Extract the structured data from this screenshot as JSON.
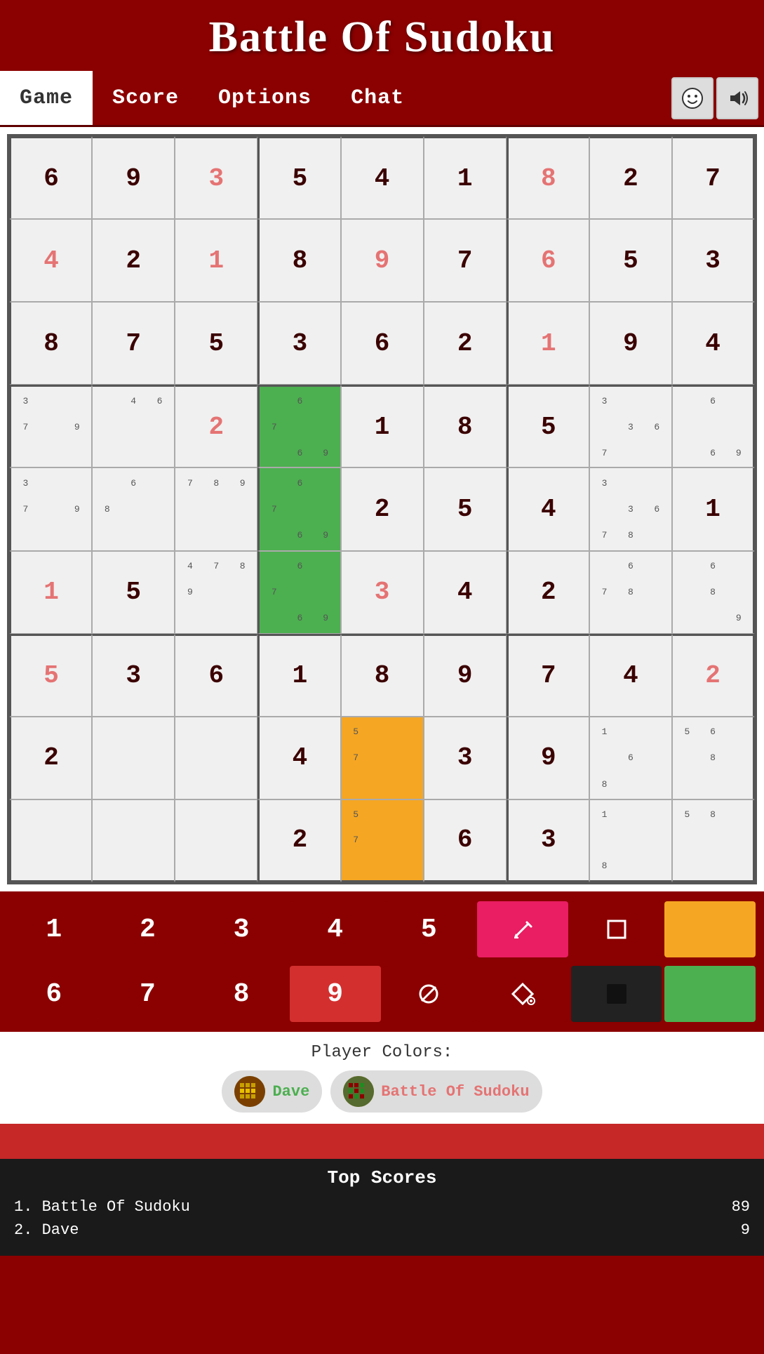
{
  "header": {
    "title": "Battle Of Sudoku"
  },
  "nav": {
    "tabs": [
      {
        "id": "game",
        "label": "Game",
        "active": true
      },
      {
        "id": "score",
        "label": "Score",
        "active": false
      },
      {
        "id": "options",
        "label": "Options",
        "active": false
      },
      {
        "id": "chat",
        "label": "Chat",
        "active": false
      }
    ]
  },
  "grid": {
    "rows": [
      [
        {
          "val": "6",
          "type": "given",
          "notes": null,
          "bg": ""
        },
        {
          "val": "9",
          "type": "given",
          "notes": null,
          "bg": ""
        },
        {
          "val": "3",
          "type": "player",
          "notes": null,
          "bg": ""
        },
        {
          "val": "5",
          "type": "given",
          "notes": null,
          "bg": ""
        },
        {
          "val": "4",
          "type": "given",
          "notes": null,
          "bg": ""
        },
        {
          "val": "1",
          "type": "given",
          "notes": null,
          "bg": ""
        },
        {
          "val": "8",
          "type": "player",
          "notes": null,
          "bg": ""
        },
        {
          "val": "2",
          "type": "given",
          "notes": null,
          "bg": ""
        },
        {
          "val": "7",
          "type": "given",
          "notes": null,
          "bg": ""
        }
      ],
      [
        {
          "val": "4",
          "type": "player",
          "notes": null,
          "bg": ""
        },
        {
          "val": "2",
          "type": "given",
          "notes": null,
          "bg": ""
        },
        {
          "val": "1",
          "type": "player",
          "notes": null,
          "bg": ""
        },
        {
          "val": "8",
          "type": "given",
          "notes": null,
          "bg": ""
        },
        {
          "val": "9",
          "type": "player",
          "notes": null,
          "bg": ""
        },
        {
          "val": "7",
          "type": "given",
          "notes": null,
          "bg": ""
        },
        {
          "val": "6",
          "type": "player",
          "notes": null,
          "bg": ""
        },
        {
          "val": "5",
          "type": "given",
          "notes": null,
          "bg": ""
        },
        {
          "val": "3",
          "type": "given",
          "notes": null,
          "bg": ""
        }
      ],
      [
        {
          "val": "8",
          "type": "given",
          "notes": null,
          "bg": ""
        },
        {
          "val": "7",
          "type": "given",
          "notes": null,
          "bg": ""
        },
        {
          "val": "5",
          "type": "given",
          "notes": null,
          "bg": ""
        },
        {
          "val": "3",
          "type": "given",
          "notes": null,
          "bg": ""
        },
        {
          "val": "6",
          "type": "given",
          "notes": null,
          "bg": ""
        },
        {
          "val": "2",
          "type": "given",
          "notes": null,
          "bg": ""
        },
        {
          "val": "1",
          "type": "player",
          "notes": null,
          "bg": ""
        },
        {
          "val": "9",
          "type": "given",
          "notes": null,
          "bg": ""
        },
        {
          "val": "4",
          "type": "given",
          "notes": null,
          "bg": ""
        }
      ],
      [
        {
          "val": "",
          "type": "notes",
          "notes": [
            "3",
            "",
            "",
            "7",
            "",
            "9"
          ],
          "bg": ""
        },
        {
          "val": "",
          "type": "notes",
          "notes": [
            "",
            "4",
            "6",
            "",
            "",
            ""
          ],
          "bg": ""
        },
        {
          "val": "2",
          "type": "player",
          "notes": null,
          "bg": ""
        },
        {
          "val": "",
          "type": "notes",
          "notes": [
            "",
            "6",
            "",
            "7",
            "",
            "",
            "",
            "6",
            "9"
          ],
          "bg": "green"
        },
        {
          "val": "1",
          "type": "given",
          "notes": null,
          "bg": ""
        },
        {
          "val": "8",
          "type": "given",
          "notes": null,
          "bg": ""
        },
        {
          "val": "5",
          "type": "given",
          "notes": null,
          "bg": ""
        },
        {
          "val": "",
          "type": "notes",
          "notes": [
            "3",
            "",
            "",
            "",
            "3",
            "6",
            "7",
            "",
            ""
          ],
          "bg": ""
        },
        {
          "val": "",
          "type": "notes",
          "notes": [
            "",
            "6",
            "",
            "",
            "",
            "",
            "",
            "6",
            "9"
          ],
          "bg": ""
        }
      ],
      [
        {
          "val": "",
          "type": "notes",
          "notes": [
            "3",
            "",
            "",
            "7",
            "",
            "9"
          ],
          "bg": ""
        },
        {
          "val": "",
          "type": "notes",
          "notes": [
            "",
            "6",
            "",
            "8",
            "",
            ""
          ],
          "bg": ""
        },
        {
          "val": "",
          "type": "notes",
          "notes": [
            "7",
            "8",
            "9",
            "",
            "",
            ""
          ],
          "bg": ""
        },
        {
          "val": "",
          "type": "notes",
          "notes": [
            "",
            "6",
            "",
            "7",
            "",
            "",
            "",
            "6",
            "9"
          ],
          "bg": "green"
        },
        {
          "val": "2",
          "type": "given",
          "notes": null,
          "bg": ""
        },
        {
          "val": "5",
          "type": "given",
          "notes": null,
          "bg": ""
        },
        {
          "val": "4",
          "type": "given",
          "notes": null,
          "bg": ""
        },
        {
          "val": "",
          "type": "notes",
          "notes": [
            "3",
            "",
            "",
            "",
            "3",
            "6",
            "7",
            "8",
            ""
          ],
          "bg": ""
        },
        {
          "val": "1",
          "type": "given",
          "notes": null,
          "bg": ""
        }
      ],
      [
        {
          "val": "1",
          "type": "player",
          "notes": null,
          "bg": ""
        },
        {
          "val": "5",
          "type": "given",
          "notes": null,
          "bg": ""
        },
        {
          "val": "",
          "type": "notes",
          "notes": [
            "4",
            "7",
            "8",
            "9",
            "",
            ""
          ],
          "bg": ""
        },
        {
          "val": "",
          "type": "notes",
          "notes": [
            "",
            "6",
            "",
            "7",
            "",
            "",
            "",
            "6",
            "9"
          ],
          "bg": "green"
        },
        {
          "val": "3",
          "type": "player",
          "notes": null,
          "bg": ""
        },
        {
          "val": "4",
          "type": "given",
          "notes": null,
          "bg": ""
        },
        {
          "val": "2",
          "type": "given",
          "notes": null,
          "bg": ""
        },
        {
          "val": "",
          "type": "notes",
          "notes": [
            "",
            "6",
            "",
            "7",
            "8",
            "",
            "",
            "",
            ""
          ],
          "bg": ""
        },
        {
          "val": "",
          "type": "notes",
          "notes": [
            "",
            "6",
            "",
            "",
            "8",
            "",
            "",
            "",
            "9"
          ],
          "bg": ""
        }
      ],
      [
        {
          "val": "5",
          "type": "player",
          "notes": null,
          "bg": ""
        },
        {
          "val": "3",
          "type": "given",
          "notes": null,
          "bg": ""
        },
        {
          "val": "6",
          "type": "given",
          "notes": null,
          "bg": ""
        },
        {
          "val": "1",
          "type": "given",
          "notes": null,
          "bg": ""
        },
        {
          "val": "8",
          "type": "given",
          "notes": null,
          "bg": ""
        },
        {
          "val": "9",
          "type": "given",
          "notes": null,
          "bg": ""
        },
        {
          "val": "7",
          "type": "given",
          "notes": null,
          "bg": ""
        },
        {
          "val": "4",
          "type": "given",
          "notes": null,
          "bg": ""
        },
        {
          "val": "2",
          "type": "player",
          "notes": null,
          "bg": ""
        }
      ],
      [
        {
          "val": "2",
          "type": "given",
          "notes": null,
          "bg": ""
        },
        {
          "val": "",
          "type": "empty",
          "notes": null,
          "bg": ""
        },
        {
          "val": "",
          "type": "empty",
          "notes": null,
          "bg": ""
        },
        {
          "val": "4",
          "type": "given",
          "notes": null,
          "bg": ""
        },
        {
          "val": "",
          "type": "notes",
          "notes": [
            "5",
            "",
            "",
            "7",
            "",
            ""
          ],
          "bg": "orange"
        },
        {
          "val": "3",
          "type": "given",
          "notes": null,
          "bg": ""
        },
        {
          "val": "9",
          "type": "given",
          "notes": null,
          "bg": ""
        },
        {
          "val": "",
          "type": "notes",
          "notes": [
            "1",
            "",
            "",
            "",
            "6",
            "",
            "8",
            "",
            ""
          ],
          "bg": ""
        },
        {
          "val": "",
          "type": "notes",
          "notes": [
            "5",
            "6",
            "",
            "",
            "8",
            "",
            "",
            "",
            ""
          ],
          "bg": ""
        }
      ],
      [
        {
          "val": "",
          "type": "empty",
          "notes": null,
          "bg": ""
        },
        {
          "val": "",
          "type": "empty",
          "notes": null,
          "bg": ""
        },
        {
          "val": "",
          "type": "empty",
          "notes": null,
          "bg": ""
        },
        {
          "val": "2",
          "type": "given",
          "notes": null,
          "bg": ""
        },
        {
          "val": "",
          "type": "notes",
          "notes": [
            "5",
            "",
            "",
            "7",
            "",
            ""
          ],
          "bg": "orange"
        },
        {
          "val": "6",
          "type": "given",
          "notes": null,
          "bg": ""
        },
        {
          "val": "3",
          "type": "given",
          "notes": null,
          "bg": ""
        },
        {
          "val": "",
          "type": "notes",
          "notes": [
            "1",
            "",
            "",
            "",
            "",
            "",
            "8",
            "",
            ""
          ],
          "bg": ""
        },
        {
          "val": "",
          "type": "notes",
          "notes": [
            "5",
            "8",
            "",
            "",
            "",
            "",
            "",
            "",
            ""
          ],
          "bg": ""
        }
      ]
    ]
  },
  "controls": {
    "row1": [
      {
        "label": "1",
        "type": "number",
        "active": false
      },
      {
        "label": "2",
        "type": "number",
        "active": false
      },
      {
        "label": "3",
        "type": "number",
        "active": false
      },
      {
        "label": "4",
        "type": "number",
        "active": false
      },
      {
        "label": "5",
        "type": "number",
        "active": false
      },
      {
        "label": "✏",
        "type": "tool",
        "active": true,
        "color": "pink"
      },
      {
        "label": "□",
        "type": "tool",
        "active": false
      },
      {
        "label": "■",
        "type": "tool",
        "active": false,
        "color": "orange"
      }
    ],
    "row2": [
      {
        "label": "6",
        "type": "number",
        "active": false
      },
      {
        "label": "7",
        "type": "number",
        "active": false
      },
      {
        "label": "8",
        "type": "number",
        "active": false
      },
      {
        "label": "9",
        "type": "number",
        "active": true,
        "color": "pink"
      },
      {
        "label": "⊘",
        "type": "tool",
        "active": false
      },
      {
        "label": "◇",
        "type": "tool",
        "active": false
      },
      {
        "label": "■",
        "type": "tool",
        "active": false,
        "color": "black"
      },
      {
        "label": "■",
        "type": "tool",
        "active": false,
        "color": "green"
      }
    ]
  },
  "players": {
    "label": "Player Colors:",
    "list": [
      {
        "name": "Dave",
        "color": "green",
        "avatar": "🎮"
      },
      {
        "name": "Battle Of Sudoku",
        "color": "red",
        "avatar": "🎮"
      }
    ]
  },
  "scores": {
    "title": "Top Scores",
    "items": [
      {
        "rank": "1. Battle Of Sudoku",
        "score": "89"
      },
      {
        "rank": "2. Dave",
        "score": "9"
      }
    ]
  }
}
